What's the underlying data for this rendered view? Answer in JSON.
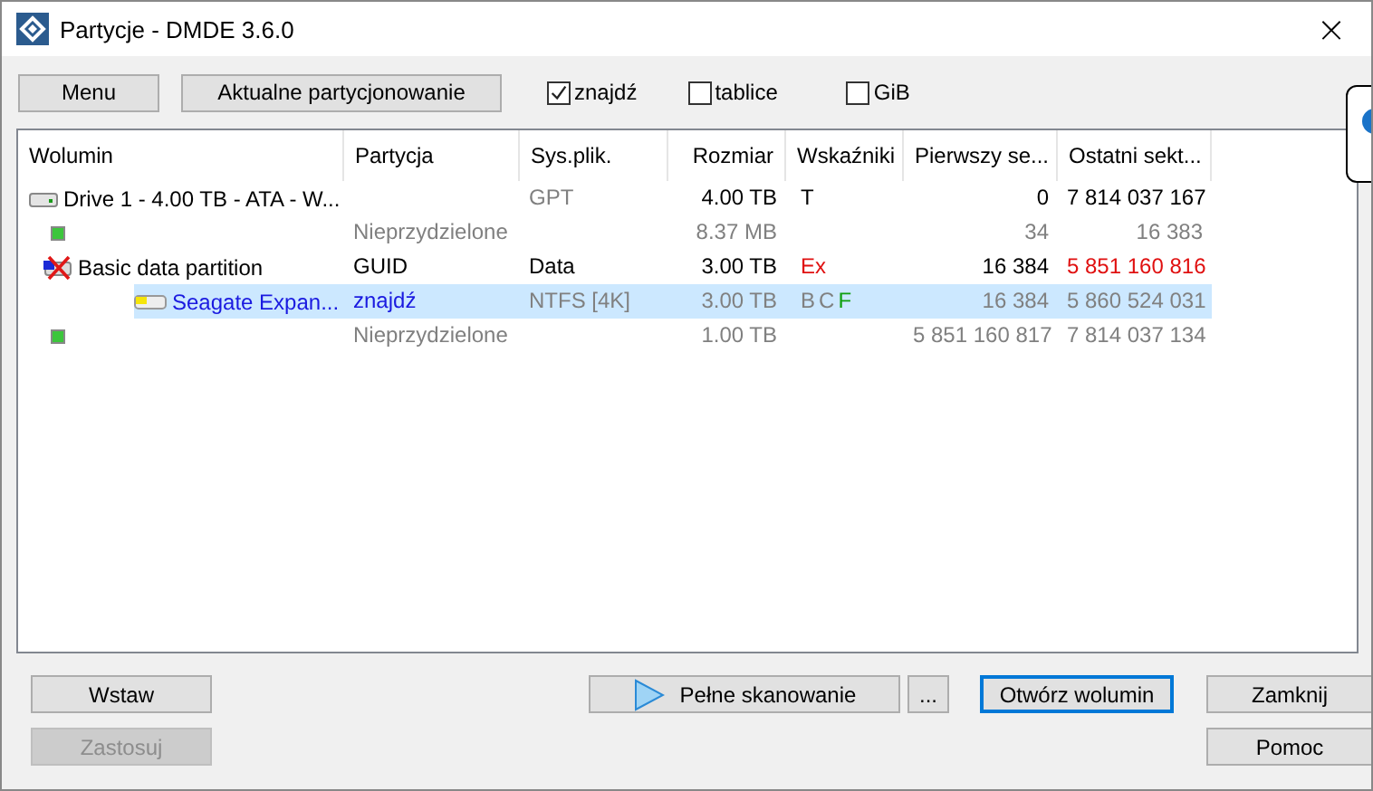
{
  "window": {
    "title": "Partycje - DMDE 3.6.0",
    "close": "×"
  },
  "toolbar": {
    "buttons": [
      "Menu",
      "Aktualne partycjonowanie"
    ],
    "checkboxes": [
      {
        "label": "znajdź",
        "checked": true
      },
      {
        "label": "tablice",
        "checked": false
      },
      {
        "label": "GiB",
        "checked": false
      }
    ]
  },
  "table": {
    "columns": [
      "Wolumin",
      "Partycja",
      "Sys.plik.",
      "Rozmiar",
      "Wskaźniki",
      "Pierwszy se...",
      "Ostatni sekt..."
    ],
    "rows": [
      {
        "kind": "drive",
        "selected": false,
        "volume": {
          "text": "Drive 1 - 4.00 TB - ATA - W...",
          "color": "#000000"
        },
        "fs": {
          "text": "GPT",
          "color": "#808080"
        },
        "size": {
          "text": "4.00 TB",
          "color": "#000000"
        },
        "flags": [
          {
            "text": "T",
            "color": "#000000"
          }
        ],
        "first": {
          "text": "0",
          "color": "#000000"
        },
        "last": {
          "text": "7 814 037 167",
          "color": "#000000"
        },
        "children": [
          {
            "kind": "free",
            "selected": false,
            "partition": {
              "text": "Nieprzydzielone",
              "color": "#808080"
            },
            "size": {
              "text": "8.37 MB",
              "color": "#808080"
            },
            "first": {
              "text": "34",
              "color": "#808080"
            },
            "last": {
              "text": "16 383",
              "color": "#808080"
            }
          },
          {
            "kind": "deleted",
            "selected": false,
            "volume": {
              "text": "Basic data partition",
              "color": "#000000"
            },
            "partition": {
              "text": "GUID",
              "color": "#000000"
            },
            "fs": {
              "text": "Data",
              "color": "#000000"
            },
            "size": {
              "text": "3.00 TB",
              "color": "#000000"
            },
            "flags": [
              {
                "text": "Ex",
                "color": "#e01010"
              }
            ],
            "first": {
              "text": "16 384",
              "color": "#000000"
            },
            "last": {
              "text": "5 851 160 816",
              "color": "#e01010"
            },
            "children": [
              {
                "kind": "found",
                "selected": true,
                "volume": {
                  "text": "Seagate Expan...",
                  "color": "#1a1ae0"
                },
                "partition": {
                  "text": "znajdź",
                  "color": "#1a1ae0"
                },
                "fs": {
                  "text": "NTFS [4K]",
                  "color": "#808080"
                },
                "size": {
                  "text": "3.00 TB",
                  "color": "#808080"
                },
                "flags": [
                  {
                    "text": "B",
                    "color": "#808080"
                  },
                  {
                    "text": "C",
                    "color": "#808080"
                  },
                  {
                    "text": "F",
                    "color": "#10a010"
                  }
                ],
                "first": {
                  "text": "16 384",
                  "color": "#808080"
                },
                "last": {
                  "text": "5 860 524 031",
                  "color": "#808080"
                }
              }
            ]
          },
          {
            "kind": "free",
            "selected": false,
            "partition": {
              "text": "Nieprzydzielone",
              "color": "#808080"
            },
            "size": {
              "text": "1.00 TB",
              "color": "#808080"
            },
            "first": {
              "text": "5 851 160 817",
              "color": "#808080"
            },
            "last": {
              "text": "7 814 037 134",
              "color": "#808080"
            }
          }
        ]
      }
    ]
  },
  "footer": {
    "left": [
      {
        "label": "Wstaw",
        "disabled": false
      },
      {
        "label": "Zastosuj",
        "disabled": true
      }
    ],
    "scan": "Pełne skanowanie",
    "more": "...",
    "open": "Otwórz wolumin",
    "right": [
      {
        "label": "Zamknij"
      },
      {
        "label": "Pomoc"
      }
    ]
  }
}
